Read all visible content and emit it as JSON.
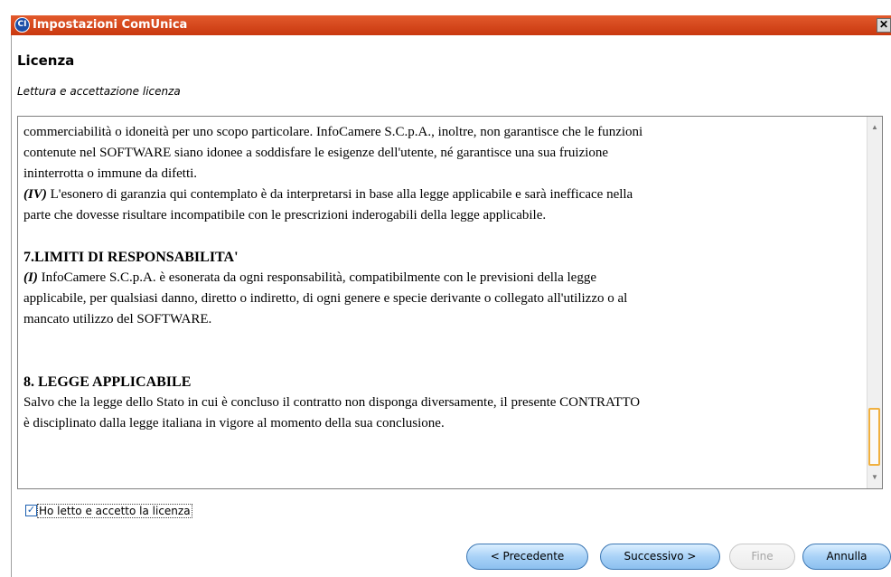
{
  "window": {
    "title": "Impostazioni ComUnica",
    "app_icon_text": "CI",
    "close_glyph": "✕"
  },
  "header": {
    "title": "Licenza",
    "subtitle": "Lettura e accettazione licenza"
  },
  "license": {
    "lines": [
      {
        "type": "para",
        "text": "commerciabilità o idoneità per uno scopo particolare. InfoCamere S.C.p.A., inoltre, non garantisce che le funzioni"
      },
      {
        "type": "para",
        "text": "contenute nel SOFTWARE siano idonee a soddisfare le esigenze dell'utente, né garantisce una sua fruizione"
      },
      {
        "type": "para",
        "text": "ininterrotta  o immune da difetti."
      },
      {
        "type": "para",
        "lead": "(IV)",
        "text": " L'esonero di garanzia qui contemplato è da interpretarsi in base alla legge applicabile e sarà inefficace nella"
      },
      {
        "type": "para",
        "text": "parte che dovesse risultare incompatibile con le prescrizioni inderogabili della legge applicabile."
      },
      {
        "type": "spacer"
      },
      {
        "type": "heading",
        "text": "7.LIMITI DI RESPONSABILITA'"
      },
      {
        "type": "para",
        "lead": "(I)",
        "text": " InfoCamere S.C.p.A. è esonerata da ogni responsabilità, compatibilmente con le previsioni della legge"
      },
      {
        "type": "para",
        "text": "applicabile, per qualsiasi danno, diretto o indiretto, di ogni genere e specie derivante o collegato all'utilizzo o al"
      },
      {
        "type": "para",
        "text": "mancato utilizzo del SOFTWARE."
      },
      {
        "type": "spacer"
      },
      {
        "type": "spacer"
      },
      {
        "type": "heading",
        "text": "8. LEGGE APPLICABILE"
      },
      {
        "type": "para",
        "text": "Salvo che la legge dello Stato in cui è concluso il contratto non disponga diversamente, il presente CONTRATTO"
      },
      {
        "type": "para",
        "text": "è disciplinato dalla legge italiana in vigore al momento della sua conclusione."
      }
    ],
    "scroll_position": 0.95
  },
  "accept": {
    "label": "Ho letto e accetto la licenza",
    "checked": true,
    "check_glyph": "✓"
  },
  "buttons": {
    "previous": "< Precedente",
    "next": "Successivo >",
    "finish": "Fine",
    "cancel": "Annulla"
  },
  "colors": {
    "titlebar": "#d8461c",
    "button_blue": "#a9d2f7",
    "scroll_thumb_border": "#f0b040"
  }
}
